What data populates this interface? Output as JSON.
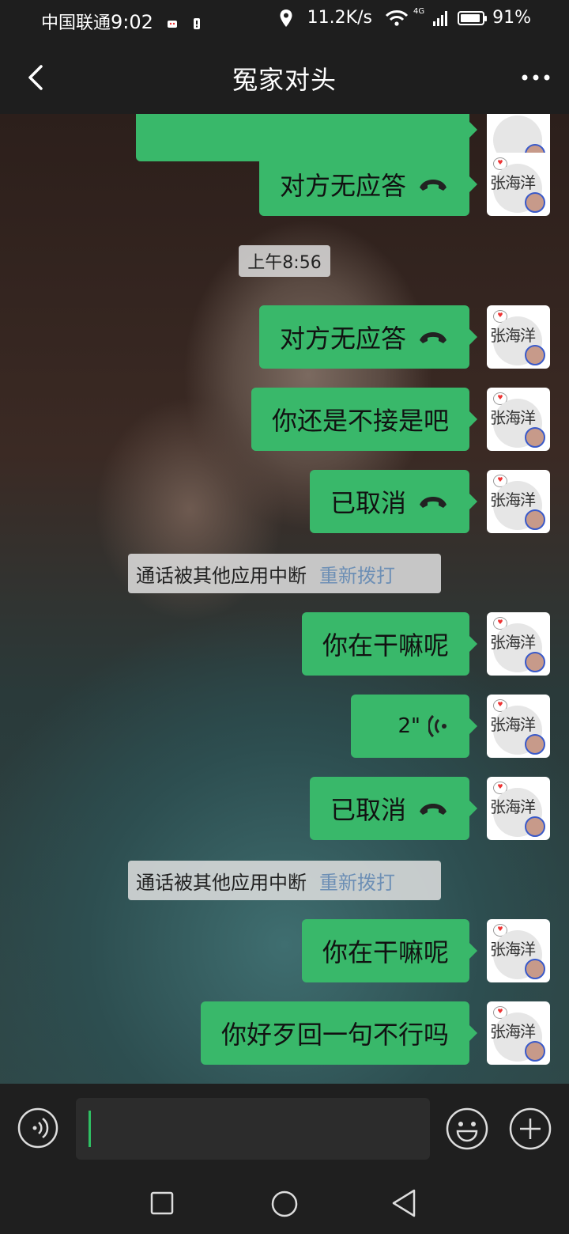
{
  "status_bar": {
    "carrier": "中国联通",
    "time": "9:02",
    "network_speed": "11.2K/s",
    "network_type": "4G",
    "battery_percent": "91%",
    "battery_level": 0.91
  },
  "header": {
    "title": "冤家对头"
  },
  "messages": [
    {
      "type": "call",
      "text": "对方无应答"
    },
    {
      "type": "timestamp",
      "text": "上午8:56"
    },
    {
      "type": "call",
      "text": "对方无应答"
    },
    {
      "type": "text",
      "text": "你还是不接是吧"
    },
    {
      "type": "call",
      "text": "已取消"
    },
    {
      "type": "system",
      "text": "通话被其他应用中断",
      "action": "重新拨打"
    },
    {
      "type": "text",
      "text": "你在干嘛呢"
    },
    {
      "type": "voice",
      "text": "2\""
    },
    {
      "type": "call",
      "text": "已取消"
    },
    {
      "type": "system",
      "text": "通话被其他应用中断",
      "action": "重新拨打"
    },
    {
      "type": "text",
      "text": "你在干嘛呢"
    },
    {
      "type": "text",
      "text": "你好歹回一句不行吗"
    }
  ],
  "avatar_signature": "张海洋",
  "colors": {
    "bubble": "#39b86a",
    "background": "#1e1e1e",
    "cursor": "#2fbf63",
    "redial_link": "#6d8fb5"
  },
  "icons": {
    "back": "chevron-left-icon",
    "more": "more-dots-icon",
    "voice_toggle": "voice-icon",
    "emoji": "emoji-icon",
    "plus": "plus-icon"
  }
}
